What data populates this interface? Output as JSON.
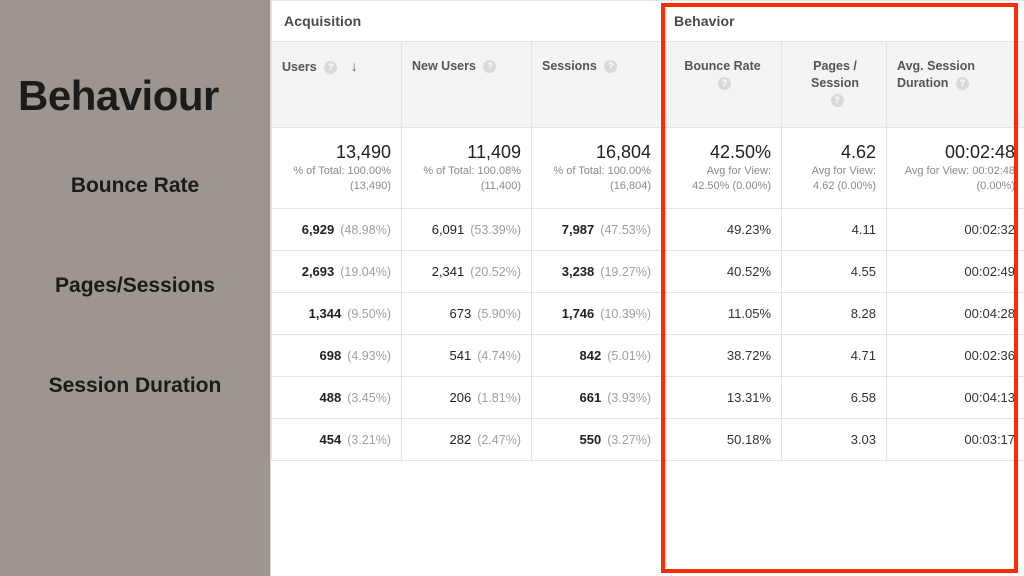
{
  "left": {
    "title": "Behaviour",
    "sub1": "Bounce Rate",
    "sub2": "Pages/Sessions",
    "sub3": "Session Duration"
  },
  "header": {
    "acquisition": "Acquisition",
    "behavior": "Behavior",
    "users": "Users",
    "new_users": "New Users",
    "sessions": "Sessions",
    "bounce_rate": "Bounce Rate",
    "pps": "Pages / Session",
    "duration": "Avg. Session Duration"
  },
  "summary": {
    "users_big": "13,490",
    "users_sub": "% of Total: 100.00% (13,490)",
    "newusers_big": "11,409",
    "newusers_sub": "% of Total: 100.08% (11,400)",
    "sessions_big": "16,804",
    "sessions_sub": "% of Total: 100.00% (16,804)",
    "bounce_big": "42.50%",
    "bounce_sub": "Avg for View: 42.50% (0.00%)",
    "pps_big": "4.62",
    "pps_sub": "Avg for View: 4.62 (0.00%)",
    "dur_big": "00:02:48",
    "dur_sub": "Avg for View: 00:02:48 (0.00%)"
  },
  "rows": [
    {
      "users_v": "6,929",
      "users_p": "(48.98%)",
      "nu_v": "6,091",
      "nu_p": "(53.39%)",
      "s_v": "7,987",
      "s_p": "(47.53%)",
      "bounce": "49.23%",
      "pps": "4.11",
      "dur": "00:02:32"
    },
    {
      "users_v": "2,693",
      "users_p": "(19.04%)",
      "nu_v": "2,341",
      "nu_p": "(20.52%)",
      "s_v": "3,238",
      "s_p": "(19.27%)",
      "bounce": "40.52%",
      "pps": "4.55",
      "dur": "00:02:49"
    },
    {
      "users_v": "1,344",
      "users_p": "(9.50%)",
      "nu_v": "673",
      "nu_p": "(5.90%)",
      "s_v": "1,746",
      "s_p": "(10.39%)",
      "bounce": "11.05%",
      "pps": "8.28",
      "dur": "00:04:28"
    },
    {
      "users_v": "698",
      "users_p": "(4.93%)",
      "nu_v": "541",
      "nu_p": "(4.74%)",
      "s_v": "842",
      "s_p": "(5.01%)",
      "bounce": "38.72%",
      "pps": "4.71",
      "dur": "00:02:36"
    },
    {
      "users_v": "488",
      "users_p": "(3.45%)",
      "nu_v": "206",
      "nu_p": "(1.81%)",
      "s_v": "661",
      "s_p": "(3.93%)",
      "bounce": "13.31%",
      "pps": "6.58",
      "dur": "00:04:13"
    },
    {
      "users_v": "454",
      "users_p": "(3.21%)",
      "nu_v": "282",
      "nu_p": "(2.47%)",
      "s_v": "550",
      "s_p": "(3.27%)",
      "bounce": "50.18%",
      "pps": "3.03",
      "dur": "00:03:17"
    }
  ]
}
